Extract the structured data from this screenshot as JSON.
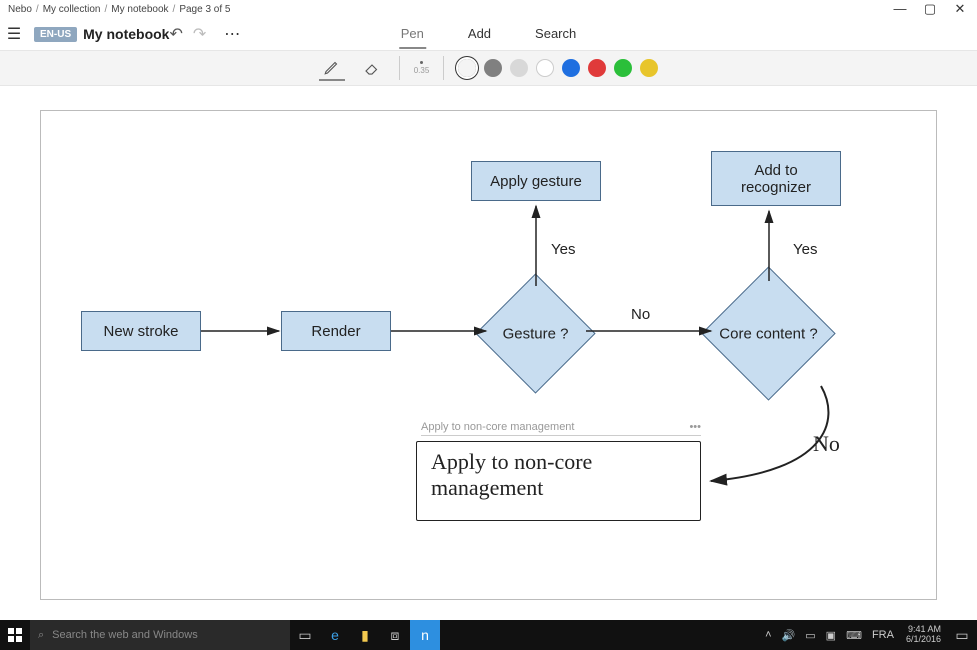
{
  "breadcrumb": [
    "Nebo",
    "My collection",
    "My notebook",
    "Page 3 of 5"
  ],
  "window": {
    "min": "—",
    "max": "▢",
    "close": "✕"
  },
  "header": {
    "lang": "EN-US",
    "title": "My notebook",
    "tabs": {
      "pen": "Pen",
      "add": "Add",
      "search": "Search"
    },
    "undo": "↶",
    "redo": "↷",
    "more": "⋯"
  },
  "toolbar": {
    "thickness": "0.35",
    "colors": [
      {
        "hex": "#000000",
        "selected": true
      },
      {
        "hex": "#808080"
      },
      {
        "hex": "#d8d8d8"
      },
      {
        "hex": "#ffffff"
      },
      {
        "hex": "#1f6fe0"
      },
      {
        "hex": "#e03a3a"
      },
      {
        "hex": "#2bbf3a"
      },
      {
        "hex": "#e8c52b"
      }
    ]
  },
  "flow": {
    "nodes": {
      "new_stroke": "New stroke",
      "render": "Render",
      "gesture": "Gesture ?",
      "apply_gesture": "Apply gesture",
      "core_content": "Core content ?",
      "add_recognizer_l1": "Add to",
      "add_recognizer_l2": "recognizer"
    },
    "edges": {
      "yes1": "Yes",
      "no1": "No",
      "yes2": "Yes",
      "no2": "No"
    },
    "handwriting": {
      "recognized": "Apply to non-core management",
      "text_l1": "Apply to non-core",
      "text_l2": "management",
      "more": "•••"
    }
  },
  "taskbar": {
    "search_placeholder": "Search the web and Windows",
    "lang": "FRA",
    "time": "9:41 AM",
    "date": "6/1/2016"
  }
}
